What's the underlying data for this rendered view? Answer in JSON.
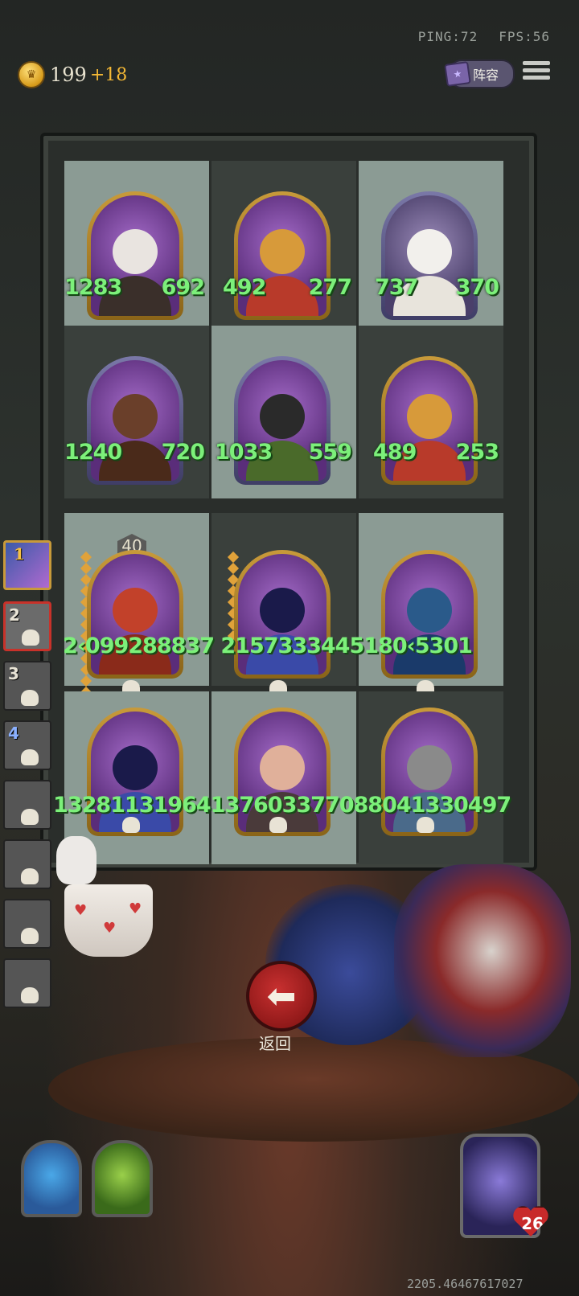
{
  "hud": {
    "ping_label": "PING:72",
    "fps_label": "FPS:56",
    "gold": "199",
    "gold_income": "+18",
    "lineup_label": "阵容"
  },
  "board": {
    "cells": [
      {
        "atk": "1283",
        "hp": "692"
      },
      {
        "atk": "492",
        "hp": "277"
      },
      {
        "atk": "737",
        "hp": "370"
      },
      {
        "atk": "1240",
        "hp": "720"
      },
      {
        "atk": "1033",
        "hp": "559"
      },
      {
        "atk": "489",
        "hp": "253"
      }
    ],
    "row3_overlapped_text": "2‹099288837 2157333445180‹5301",
    "row4_overlapped_text": "13281131964137603377088041330497",
    "star_badge": "40"
  },
  "roster": {
    "items": [
      {
        "num": "1"
      },
      {
        "num": "2"
      },
      {
        "num": "3"
      },
      {
        "num": "4"
      }
    ]
  },
  "actions": {
    "back_label": "返回"
  },
  "player": {
    "life": "26"
  },
  "footer": {
    "coords": "2205.46467617027"
  }
}
